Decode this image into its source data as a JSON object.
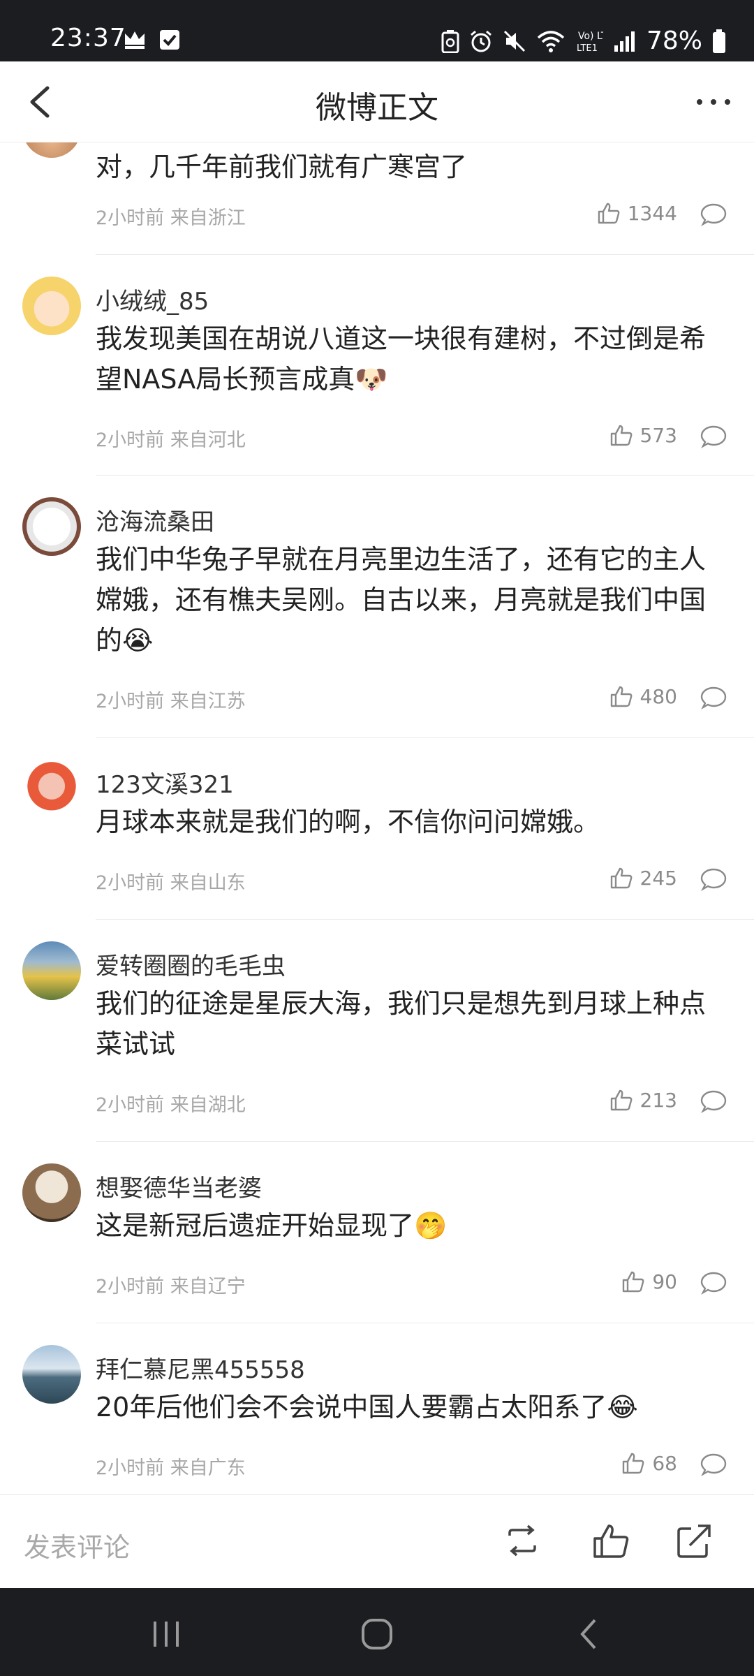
{
  "status_bar": {
    "time": "23:37",
    "left_icons": [
      "crown-icon",
      "check-box-icon"
    ],
    "right_icons": [
      "battery-saver-icon",
      "alarm-icon",
      "mute-icon",
      "wifi-icon",
      "volte-icon",
      "signal-icon",
      "battery-icon"
    ],
    "volte_label": "Vo) LTE1",
    "battery": "78%"
  },
  "nav": {
    "title": "微博正文",
    "back_icon": "chevron-left-icon",
    "more_icon": "more-dots-icon"
  },
  "comments": [
    {
      "username": "",
      "text": "对，几千年前我们就有广寒宫了",
      "time": "2小时前",
      "location": "来自浙江",
      "likes": "1344"
    },
    {
      "username": "小绒绒_85",
      "text": "我发现美国在胡说八道这一块很有建树，不过倒是希望NASA局长预言成真",
      "emoji": "🐶",
      "time": "2小时前",
      "location": "来自河北",
      "likes": "573"
    },
    {
      "username": "沧海流桑田",
      "text": "我们中华兔子早就在月亮里边生活了，还有它的主人嫦娥，还有樵夫吴刚。自古以来，月亮就是我们中国的",
      "emoji": "😭",
      "time": "2小时前",
      "location": "来自江苏",
      "likes": "480"
    },
    {
      "username": "123文溪321",
      "text": "月球本来就是我们的啊，不信你问问嫦娥。",
      "time": "2小时前",
      "location": "来自山东",
      "likes": "245"
    },
    {
      "username": "爱转圈圈的毛毛虫",
      "text": "我们的征途是星辰大海，我们只是想先到月球上种点菜试试",
      "time": "2小时前",
      "location": "来自湖北",
      "likes": "213"
    },
    {
      "username": "想娶德华当老婆",
      "text": "这是新冠后遗症开始显现了",
      "emoji": "🤭",
      "time": "2小时前",
      "location": "来自辽宁",
      "likes": "90"
    },
    {
      "username": "拜仁慕尼黑455558",
      "text": "20年后他们会不会说中国人要霸占太阳系了",
      "emoji": "😂",
      "time": "2小时前",
      "location": "来自广东",
      "likes": "68"
    }
  ],
  "bottom_bar": {
    "post_comment_placeholder": "发表评论",
    "icons": [
      "repost-icon",
      "like-icon",
      "share-icon"
    ]
  },
  "system_nav": {
    "icons": [
      "recent-apps-icon",
      "home-icon",
      "back-icon"
    ]
  },
  "colors": {
    "status_bar_bg": "#1b1d21",
    "text_primary": "#222222",
    "text_meta": "#a7a7a7",
    "divider": "#ebebeb"
  }
}
